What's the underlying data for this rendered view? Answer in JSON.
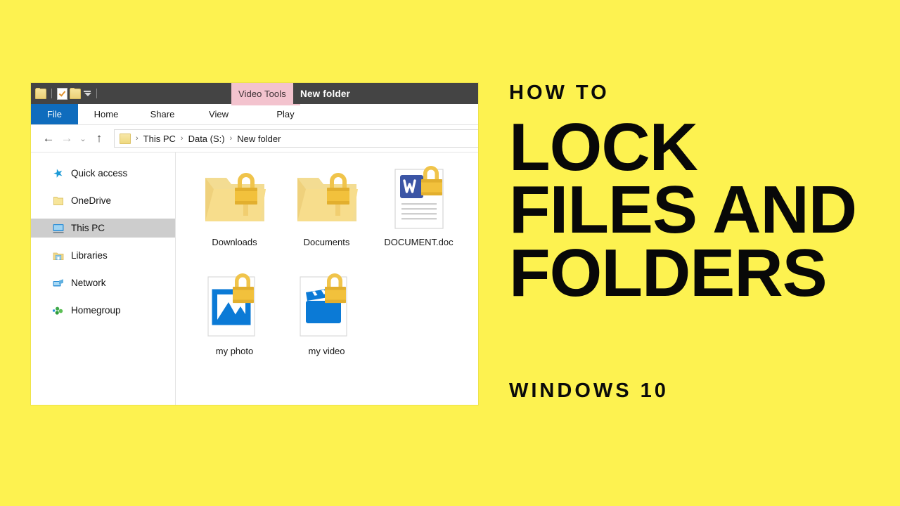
{
  "page": {
    "background_color": "#FDF250",
    "accent_color": "#0F6CBD",
    "context_tab_color": "#F3C3CE",
    "lock_color": "#F2C13C"
  },
  "promo": {
    "kicker": "HOW TO",
    "headline_line1": "LOCK",
    "headline_line2": "FILES AND",
    "headline_line3": "FOLDERS",
    "footer": "WINDOWS 10"
  },
  "explorer": {
    "titlebar": {
      "context_tab": "Video Tools",
      "window_title": "New folder",
      "quick_access": [
        {
          "name": "folder-icon"
        },
        {
          "name": "properties-icon"
        },
        {
          "name": "new-folder-icon"
        },
        {
          "name": "customize-chevron-icon"
        }
      ]
    },
    "ribbon": {
      "tabs": [
        {
          "label": "File",
          "selected": true
        },
        {
          "label": "Home",
          "selected": false
        },
        {
          "label": "Share",
          "selected": false
        },
        {
          "label": "View",
          "selected": false
        }
      ],
      "contextual_tab": {
        "label": "Play"
      }
    },
    "address_bar": {
      "back": "←",
      "forward": "→",
      "recent": "⌄",
      "up": "↑",
      "breadcrumbs": [
        "This PC",
        "Data (S:)",
        "New folder"
      ],
      "separator": "›"
    },
    "nav_pane": {
      "items": [
        {
          "label": "Quick access",
          "icon": "star-icon",
          "selected": false
        },
        {
          "label": "OneDrive",
          "icon": "onedrive-folder-icon",
          "selected": false
        },
        {
          "label": "This PC",
          "icon": "monitor-icon",
          "selected": true
        },
        {
          "label": "Libraries",
          "icon": "libraries-icon",
          "selected": false
        },
        {
          "label": "Network",
          "icon": "network-icon",
          "selected": false
        },
        {
          "label": "Homegroup",
          "icon": "homegroup-icon",
          "selected": false
        }
      ]
    },
    "files": [
      {
        "label": "Downloads",
        "type": "folder",
        "locked": true
      },
      {
        "label": "Documents",
        "type": "folder",
        "locked": true
      },
      {
        "label": "DOCUMENT.doc",
        "type": "word-document",
        "locked": true
      },
      {
        "label": "my photo",
        "type": "image",
        "locked": true
      },
      {
        "label": "my video",
        "type": "video",
        "locked": true
      }
    ]
  }
}
